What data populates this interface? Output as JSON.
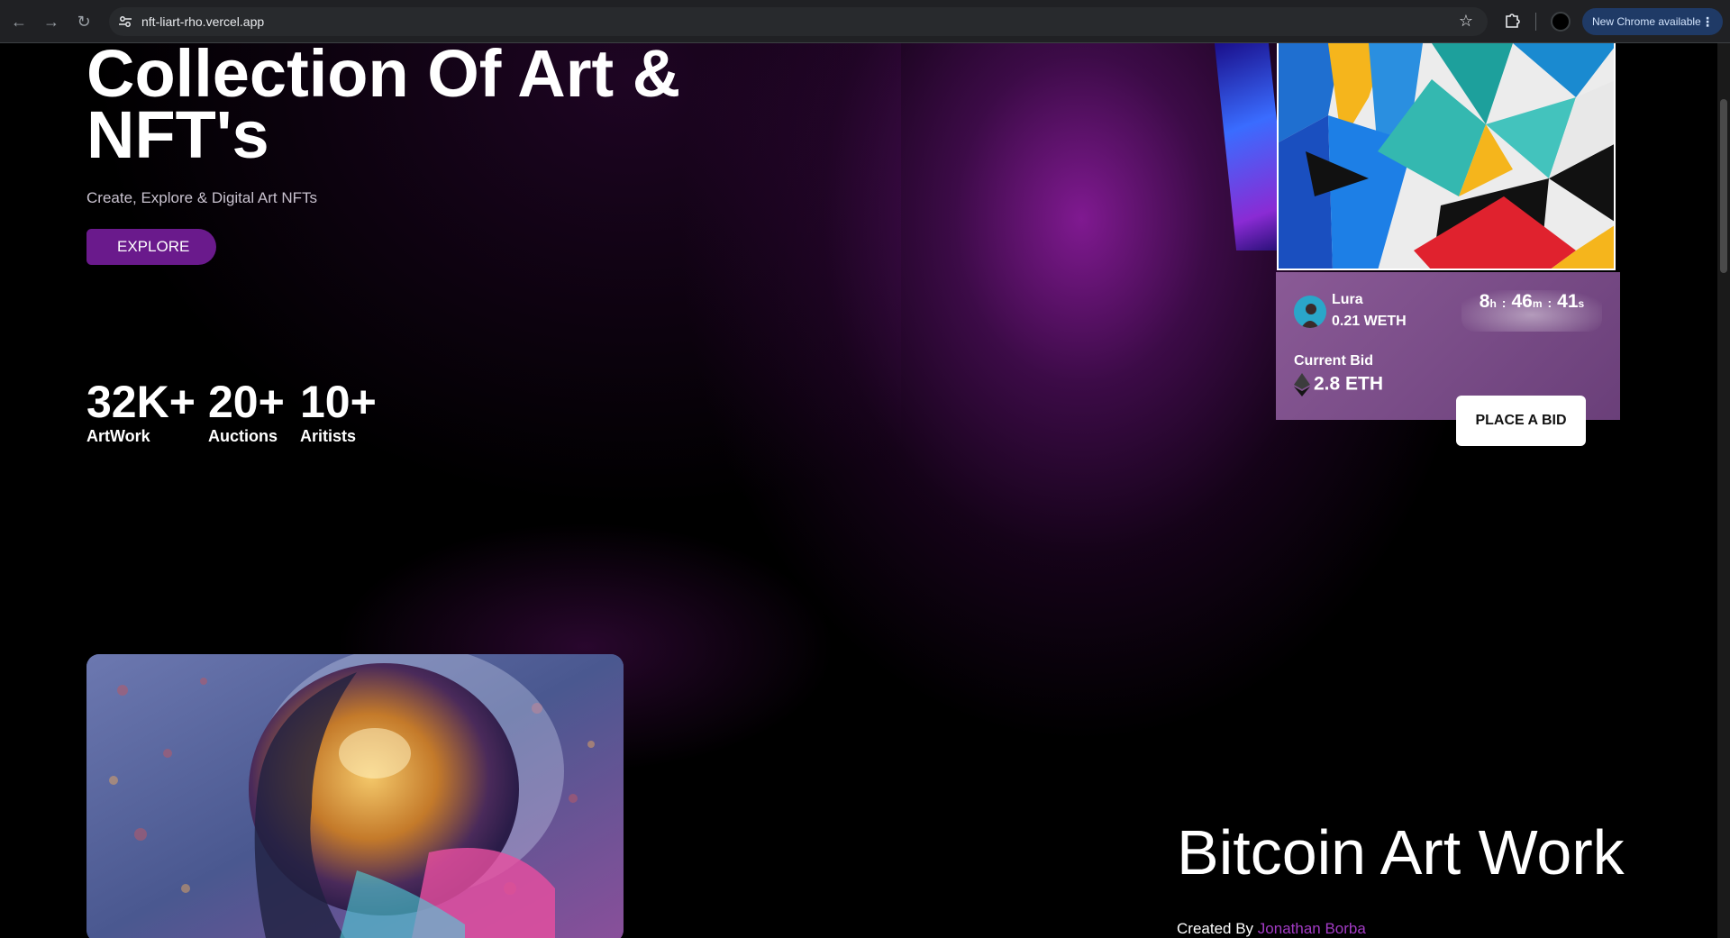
{
  "browser": {
    "url": "nft-liart-rho.vercel.app",
    "update_label": "New Chrome available"
  },
  "hero": {
    "title": "Collection Of Art & NFT's",
    "subtitle": "Create, Explore & Digital Art NFTs",
    "explore_label": "EXPLORE"
  },
  "stats": [
    {
      "value": "32K+",
      "label": "ArtWork"
    },
    {
      "value": "20+",
      "label": "Auctions"
    },
    {
      "value": "10+",
      "label": "Aritists"
    }
  ],
  "auction": {
    "seller_name": "Lura",
    "seller_price": "0.21 WETH",
    "timer": {
      "hours": "8",
      "h_unit": "h",
      "minutes": "46",
      "m_unit": "m",
      "seconds": "41",
      "s_unit": "s"
    },
    "current_bid_label": "Current Bid",
    "current_bid_value": "2.8 ETH",
    "place_bid_label": "PLACE A BID"
  },
  "featured": {
    "title": "Bitcoin Art Work",
    "created_by_label": "Created By",
    "author": "Jonathan Borba"
  },
  "colors": {
    "accent": "#6a1a8c",
    "author": "#a23bc4",
    "card": "#7a4d88"
  }
}
